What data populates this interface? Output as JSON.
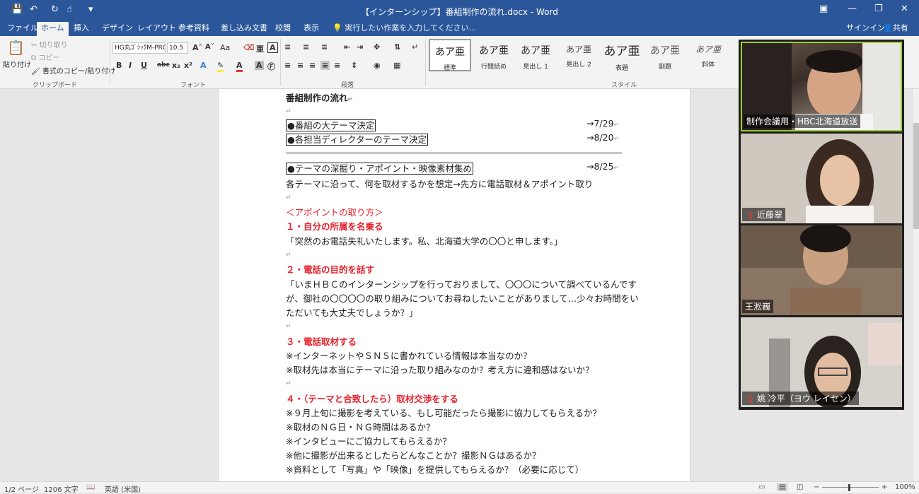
{
  "window": {
    "title": "【インターンシップ】番組制作の流れ.docx - Word"
  },
  "ribbon_tabs": [
    "ファイル",
    "ホーム",
    "挿入",
    "デザイン",
    "レイアウト",
    "参考資料",
    "差し込み文書",
    "校閲",
    "表示"
  ],
  "tell_me": "実行したい作業を入力してください...",
  "account": {
    "signin": "サインイン",
    "share": "共有"
  },
  "clipboard": {
    "paste": "貼り付け",
    "cut": "切り取り",
    "copy": "コピー",
    "format_painter": "書式のコピー/貼り付け",
    "label": "クリップボード"
  },
  "font": {
    "name": "HG丸ｺﾞｼｯｸM-PRO",
    "size": "10.5",
    "label": "フォント",
    "aa": "Aa"
  },
  "paragraph": {
    "label": "段落"
  },
  "styles": {
    "label": "スタイル",
    "items": [
      {
        "preview": "あア亜",
        "name": "標準"
      },
      {
        "preview": "あア亜",
        "name": "行間詰め"
      },
      {
        "preview": "あア亜",
        "name": "見出し 1"
      },
      {
        "preview": "あア亜",
        "name": "見出し 2"
      },
      {
        "preview": "あア亜",
        "name": "表題"
      },
      {
        "preview": "あア亜",
        "name": "副題"
      },
      {
        "preview": "あア亜",
        "name": "斜体"
      }
    ]
  },
  "document": {
    "heading": "番組制作の流れ",
    "milestones": [
      {
        "text": "●番組の大テーマ決定",
        "date": "→7/29"
      },
      {
        "text": "●各担当ディレクターのテーマ決定",
        "date": "→8/20"
      },
      {
        "text": "●テーマの深掘り・アポイント・映像素材集め",
        "date": "→8/25"
      }
    ],
    "lines": [
      "各テーマに沿って、何を取材するかを想定→先方に電話取材＆アポイント取り",
      "＜アポイントの取り方＞",
      "１・自分の所属を名乗る",
      "「突然のお電話失礼いたします。私、北海道大学の〇〇と申します。」",
      "２・電話の目的を話す",
      "「いまＨＢＣのインターンシップを行っておりまして、〇〇〇について調べているんです",
      "が、御社の〇〇〇〇の取り組みについてお尋ねしたいことがありまして…少々お時間をい",
      "ただいても大丈夫でしょうか？」",
      "３・電話取材する",
      "※インターネットやＳＮＳに書かれている情報は本当なのか？",
      "※取材先は本当にテーマに沿った取り組みなのか？考え方に違和感はないか？",
      "４・（テーマと合致したら）取材交渉をする",
      "※９月上旬に撮影を考えている、もし可能だったら撮影に協力してもらえるか？",
      "※取材のＮＧ日・ＮＧ時間はあるか？",
      "※インタビューにご協力してもらえるか？",
      "※他に撮影が出来るとしたらどんなことか？撮影ＮＧはあるか？",
      "※資料として「写真」や「映像」を提供してもらえるか？（必要に応じて）"
    ]
  },
  "participants": [
    {
      "name": "制作会議用・HBC北海道放送",
      "muted": false
    },
    {
      "name": "近藤翠",
      "muted": true
    },
    {
      "name": "王淞巍",
      "muted": false
    },
    {
      "name": "姚 冷平（ヨウ レイセン）",
      "muted": true
    }
  ],
  "status": {
    "page": "1/2 ページ",
    "words": "1206 文字",
    "language": "英語 (米国)",
    "zoom": "100%"
  }
}
